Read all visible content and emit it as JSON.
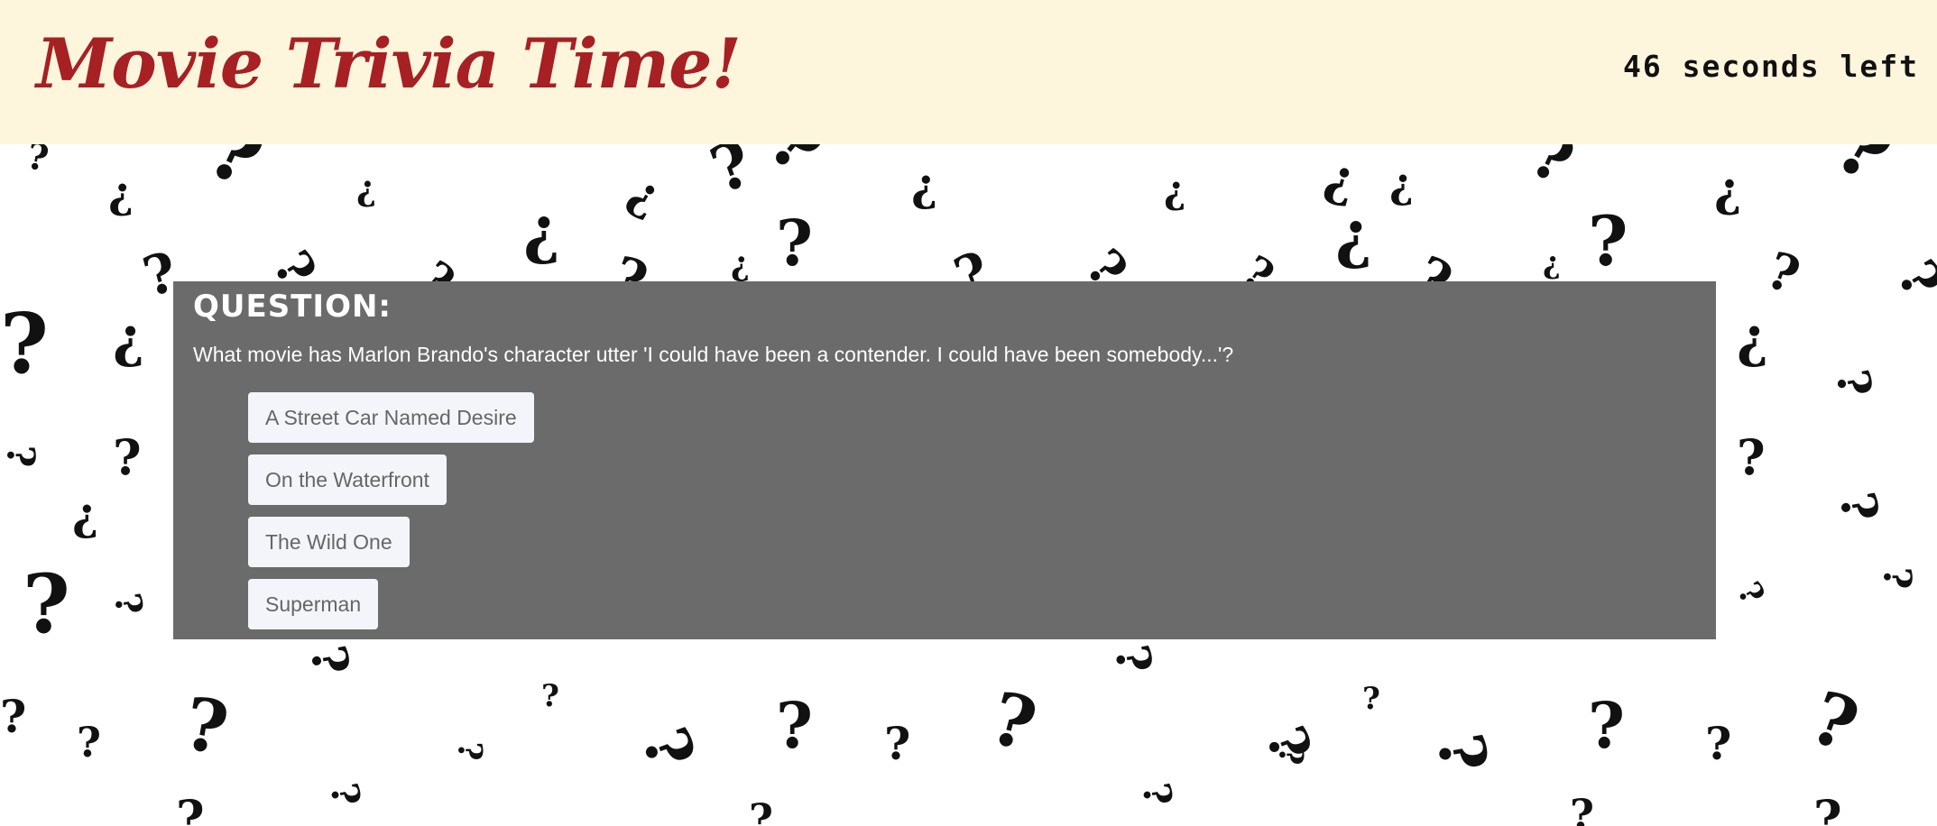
{
  "header": {
    "title": "Movie Trivia Time!",
    "timer": "46 seconds left"
  },
  "question": {
    "heading": "QUESTION:",
    "text": "What movie has Marlon Brando's character utter 'I could have been a contender. I could have been somebody...'?",
    "answers": [
      {
        "label": "A Street Car Named Desire"
      },
      {
        "label": "On the Waterfront"
      },
      {
        "label": "The Wild One"
      },
      {
        "label": "Superman"
      }
    ]
  },
  "colors": {
    "header_background": "#fef6dc",
    "title": "#a72023",
    "panel_background": "#6b6b6b",
    "answer_button_background": "#f4f5fb",
    "answer_button_text": "#666666"
  }
}
